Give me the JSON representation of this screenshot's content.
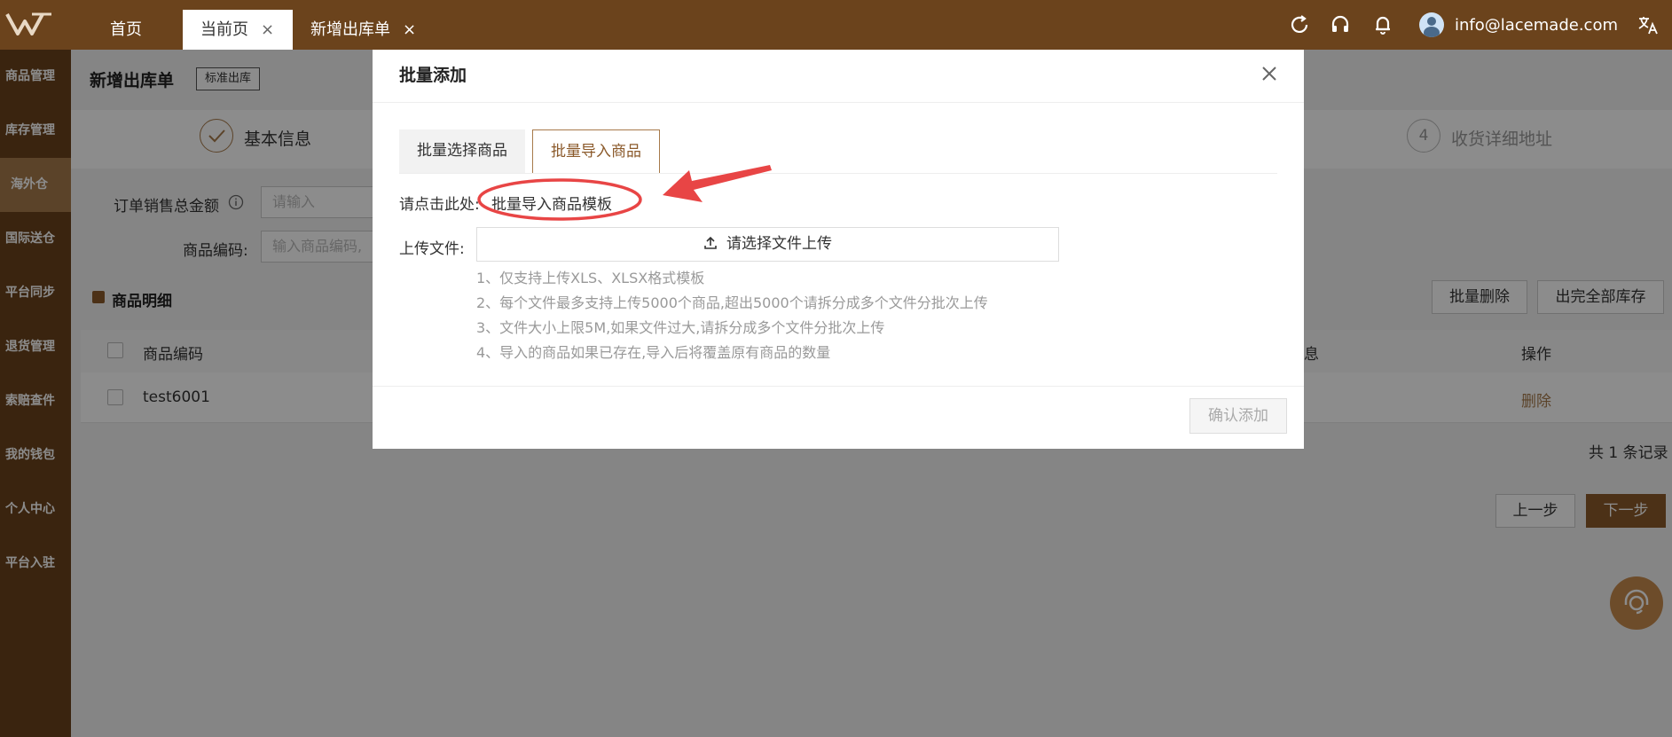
{
  "topbar": {
    "tabs": [
      {
        "label": "首页"
      },
      {
        "label": "当前页",
        "close": "×"
      },
      {
        "label": "新增出库单",
        "close": "×"
      }
    ],
    "user_email": "info@lacemade.com",
    "icons": [
      "refresh-icon",
      "headset-icon",
      "bell-icon",
      "translate-icon"
    ]
  },
  "sidebar": {
    "items": [
      {
        "label": "商品管理"
      },
      {
        "label": "库存管理"
      },
      {
        "label": "海外仓"
      },
      {
        "label": "国际送仓"
      },
      {
        "label": "平台同步"
      },
      {
        "label": "退货管理"
      },
      {
        "label": "索赔查件"
      },
      {
        "label": "我的钱包"
      },
      {
        "label": "个人中心"
      },
      {
        "label": "平台入驻"
      }
    ],
    "active_index": 2
  },
  "page": {
    "title": "新增出库单",
    "tag": "标准出库",
    "steps": [
      {
        "label": "基本信息",
        "status": "done"
      },
      {
        "number": "4",
        "label": "收货详细地址",
        "status": "pending"
      }
    ],
    "form": {
      "total_label": "订单销售总金额",
      "total_placeholder": "请输入",
      "code_label": "商品编码:",
      "code_placeholder": "输入商品编码,"
    },
    "section_title": "商品明细",
    "batch_delete": "批量删除",
    "outbound_all": "出完全部库存",
    "table": {
      "col_code": "商品编码",
      "col_info_partial": "息",
      "col_action": "操作",
      "rows": [
        {
          "code": "test6001",
          "action": "删除"
        }
      ]
    },
    "total_records": "共 1 条记录",
    "prev": "上一步",
    "next": "下一步"
  },
  "modal": {
    "title": "批量添加",
    "tabs": [
      {
        "label": "批量选择商品",
        "active": false
      },
      {
        "label": "批量导入商品",
        "active": true
      }
    ],
    "template_prefix": "请点击此处:",
    "template_link": "批量导入商品模板",
    "upload_label": "上传文件:",
    "upload_button": "请选择文件上传",
    "hints": [
      "1、仅支持上传XLS、XLSX格式模板",
      "2、每个文件最多支持上传5000个商品,超出5000个请拆分成多个文件分批次上传",
      "3、文件大小上限5M,如果文件过大,请拆分成多个文件分批次上传",
      "4、导入的商品如果已存在,导入后将覆盖原有商品的数量"
    ],
    "confirm": "确认添加"
  },
  "colors": {
    "brand": "#6b431c",
    "accent": "#a77a4b",
    "annotation": "#e84545"
  }
}
